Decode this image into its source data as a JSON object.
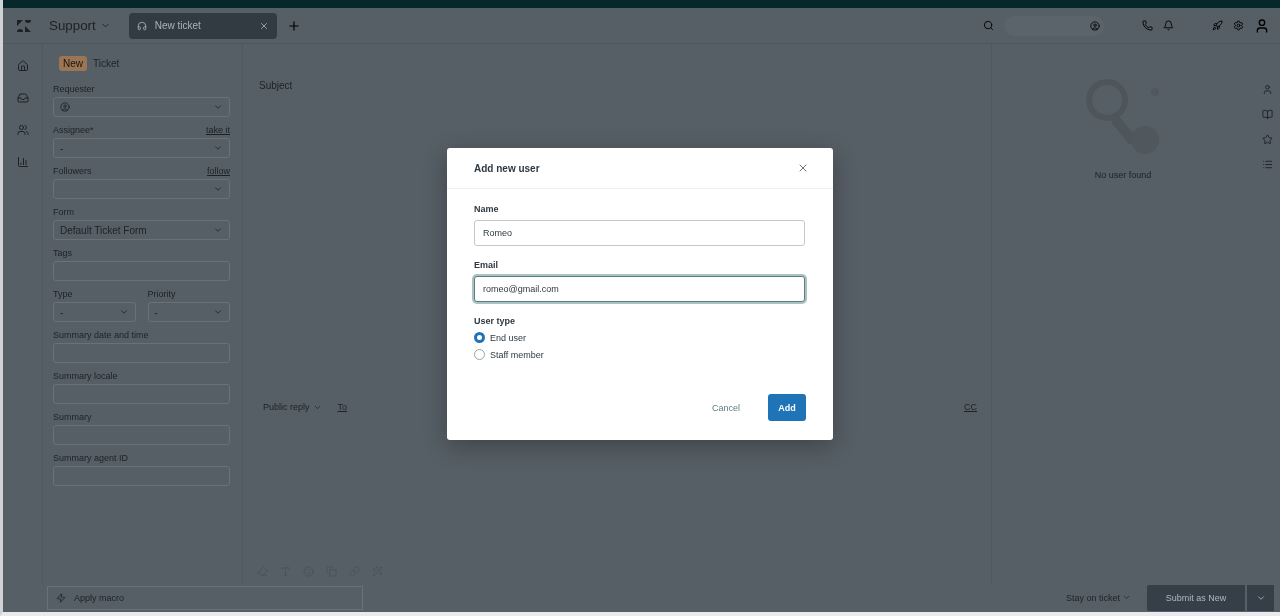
{
  "header": {
    "workspace": "Support",
    "tab": {
      "label": "New ticket"
    }
  },
  "ticket_header": {
    "badge": "New",
    "title": "Ticket"
  },
  "fields": [
    {
      "kind": "user_select",
      "label": "Requester"
    },
    {
      "kind": "select",
      "label": "Assignee*",
      "action": "take it",
      "value": "-"
    },
    {
      "kind": "select",
      "label": "Followers",
      "action": "follow"
    },
    {
      "kind": "select",
      "label": "Form",
      "value": "Default Ticket Form"
    },
    {
      "kind": "text",
      "label": "Tags"
    },
    {
      "kind": "pair",
      "items": [
        {
          "label": "Type",
          "value": "-"
        },
        {
          "label": "Priority",
          "value": "-"
        }
      ]
    },
    {
      "kind": "text",
      "label": "Summary date and time"
    },
    {
      "kind": "text",
      "label": "Summary locale"
    },
    {
      "kind": "text",
      "label": "Summary"
    },
    {
      "kind": "text",
      "label": "Summary agent ID"
    }
  ],
  "subject": {
    "placeholder": "Subject"
  },
  "reply": {
    "channel": "Public reply",
    "to": "To",
    "cc": "CC"
  },
  "context": {
    "message": "No user found"
  },
  "macro": {
    "placeholder": "Apply macro"
  },
  "footer": {
    "after_submit": "Stay on ticket",
    "submit": "Submit as New"
  },
  "dialog": {
    "title": "Add new user",
    "fields": [
      {
        "label": "Name",
        "value": "Romeo",
        "focused": false
      },
      {
        "label": "Email",
        "value": "romeo@gmail.com",
        "focused": true
      }
    ],
    "user_type": {
      "label": "User type",
      "options": [
        {
          "label": "End user",
          "selected": true
        },
        {
          "label": "Staff member",
          "selected": false
        }
      ]
    },
    "cancel": "Cancel",
    "add": "Add"
  }
}
